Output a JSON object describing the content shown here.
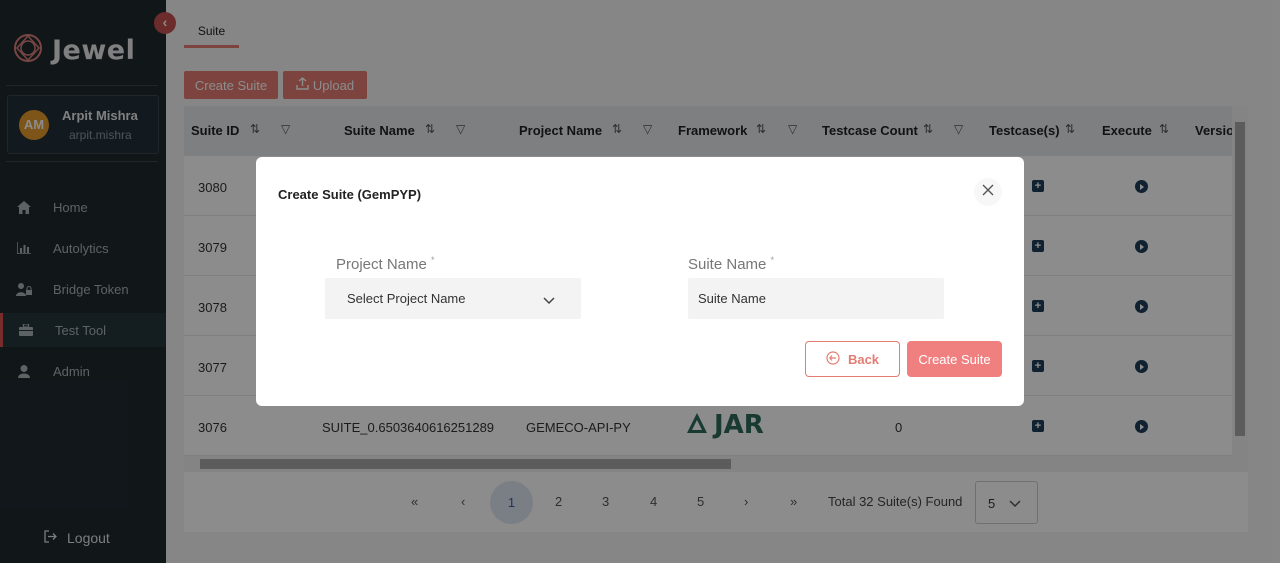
{
  "sidebar": {
    "brand": "Jewel",
    "user": {
      "initials": "AM",
      "name": "Arpit Mishra",
      "handle": "arpit.mishra"
    },
    "items": [
      {
        "label": "Home",
        "icon": "home-icon"
      },
      {
        "label": "Autolytics",
        "icon": "bar-chart-icon"
      },
      {
        "label": "Bridge Token",
        "icon": "users-lock-icon"
      },
      {
        "label": "Test Tool",
        "icon": "toolbox-icon",
        "active": true
      },
      {
        "label": "Admin",
        "icon": "user-icon"
      }
    ],
    "logout": "Logout"
  },
  "tab": "Suite",
  "toolbar": {
    "create_suite": "Create Suite",
    "upload": "Upload"
  },
  "table": {
    "columns": [
      "Suite ID",
      "Suite Name",
      "Project Name",
      "Framework",
      "Testcase Count",
      "Testcase(s)",
      "Execute",
      "Versio"
    ],
    "rows": [
      {
        "id": "3080"
      },
      {
        "id": "3079"
      },
      {
        "id": "3078"
      },
      {
        "id": "3077"
      },
      {
        "id": "3076",
        "suite_name": "SUITE_0.6503640616251289",
        "project": "GEMECO-API-PY",
        "framework": "JAR",
        "count": "0"
      }
    ]
  },
  "pagination": {
    "first": "«",
    "prev": "‹",
    "pages": [
      "1",
      "2",
      "3",
      "4",
      "5"
    ],
    "next": "›",
    "last": "»",
    "total": "Total 32 Suite(s) Found",
    "page_size": "5"
  },
  "modal": {
    "title": "Create Suite (GemPYP)",
    "project_label": "Project Name",
    "project_placeholder": "Select Project Name",
    "suite_label": "Suite Name",
    "suite_placeholder": "Suite Name",
    "required_mark": "*",
    "back": "Back",
    "create": "Create Suite"
  },
  "colors": {
    "accent": "#e37c73",
    "sidebar": "#1f2a2f",
    "create_button": "#f08080",
    "icon_dark": "#1e3c5a"
  }
}
